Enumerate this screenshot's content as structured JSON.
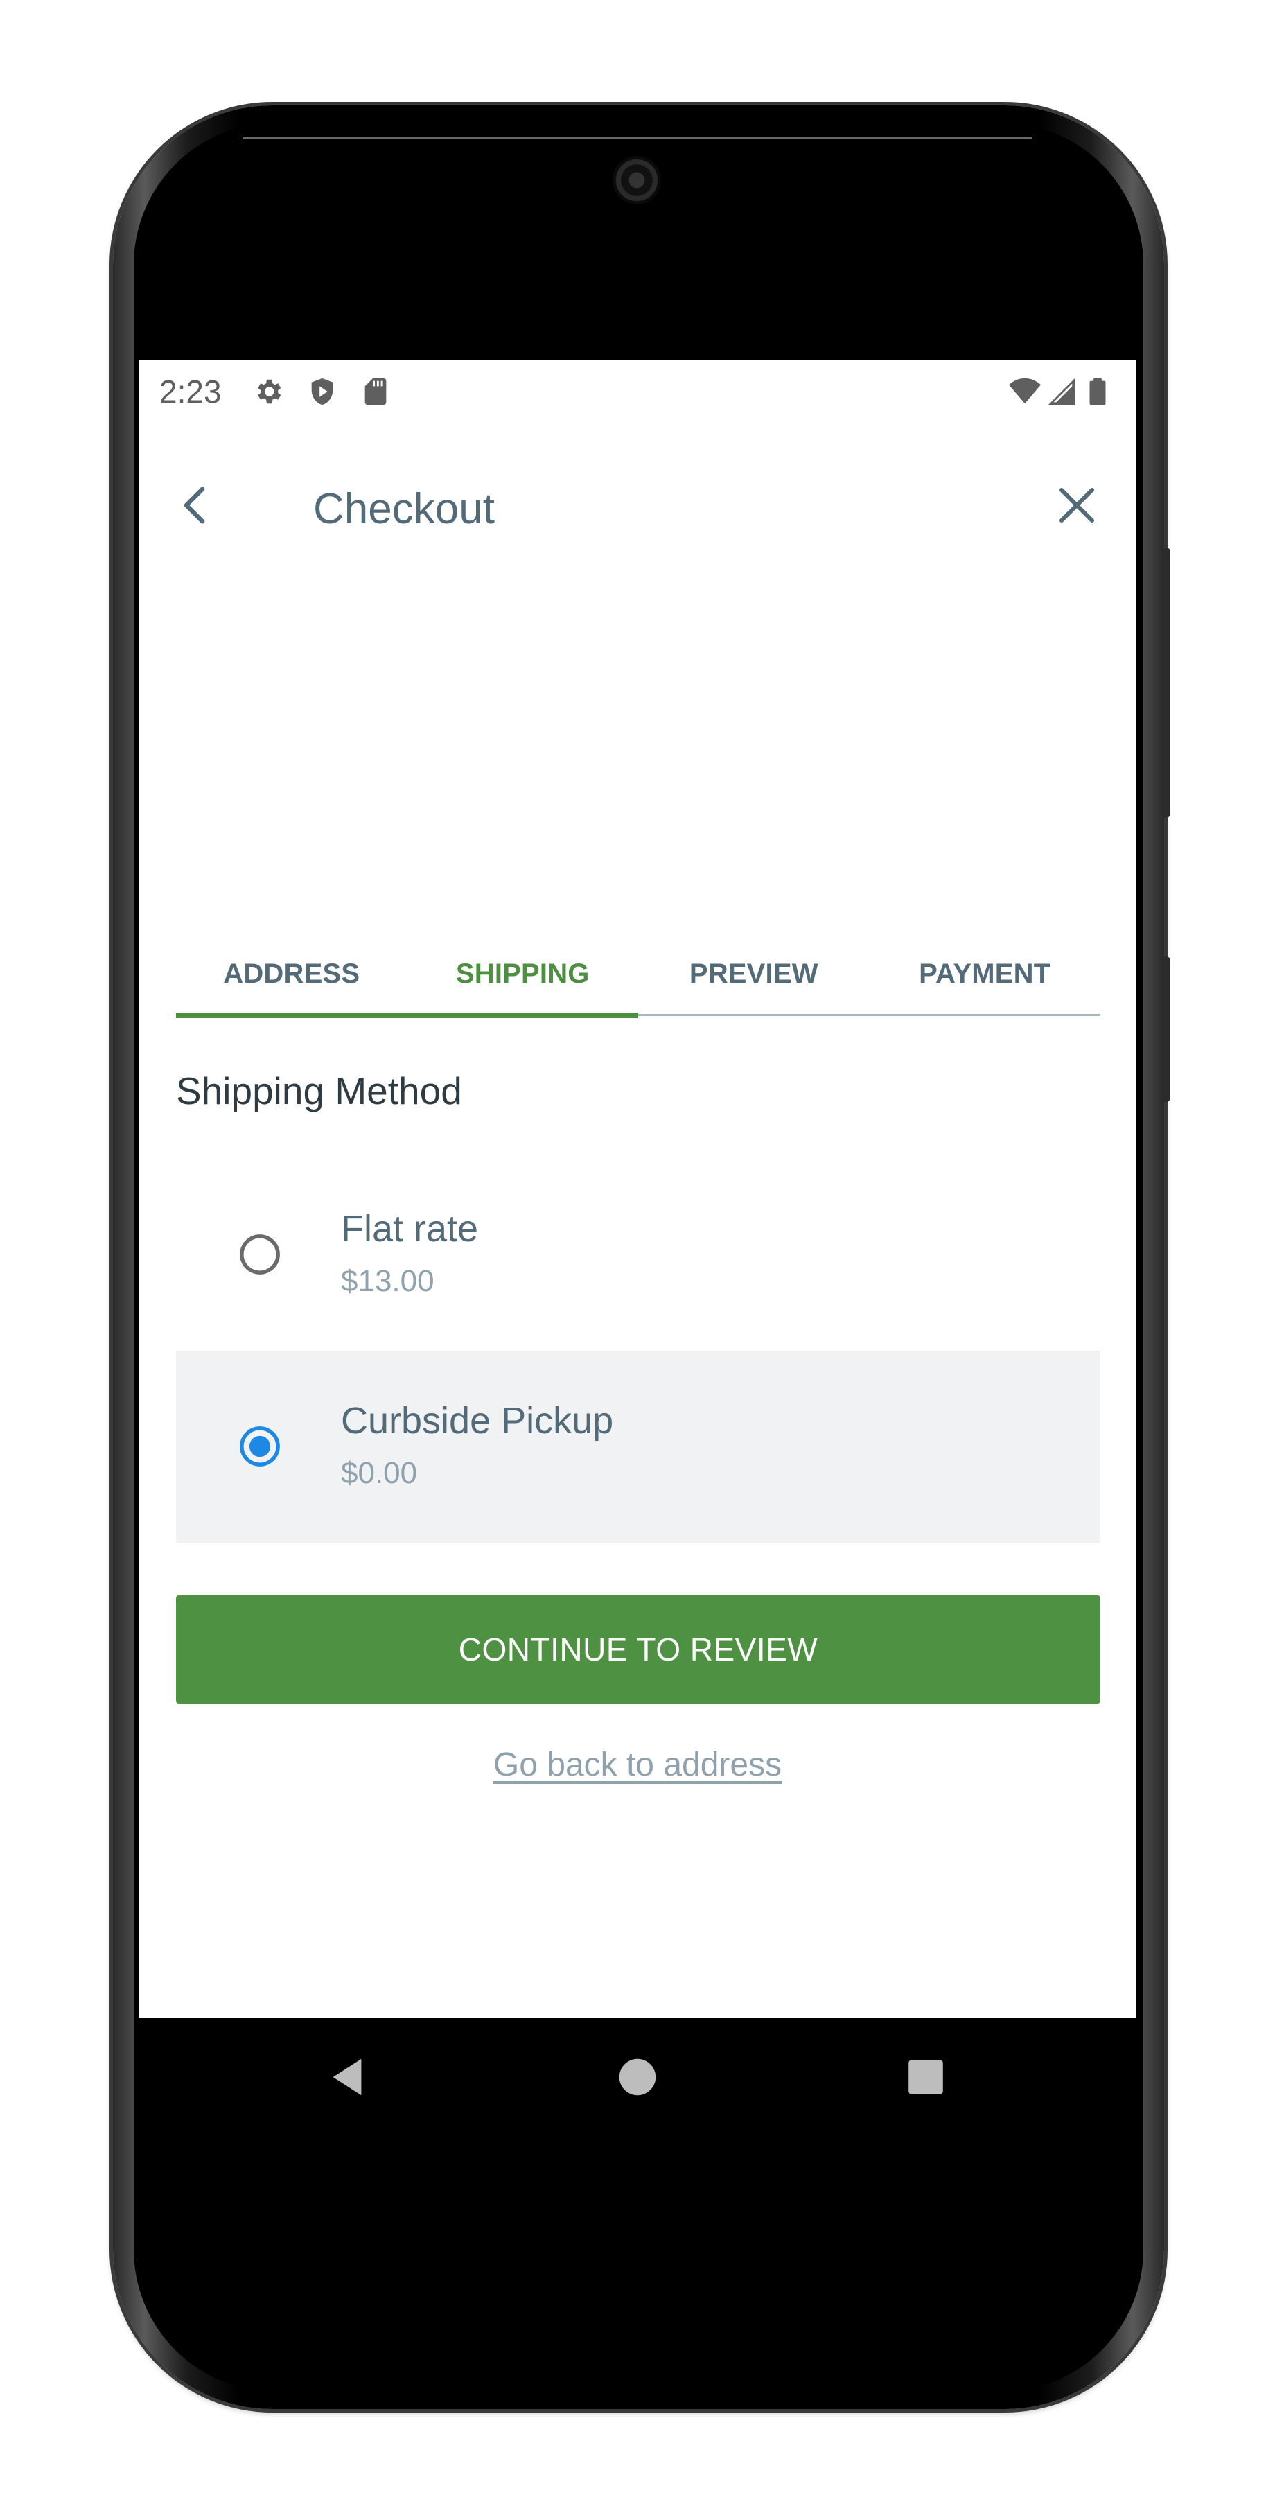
{
  "status_bar": {
    "time": "2:23",
    "left_icons": [
      "gear-icon",
      "shield-icon",
      "sd-card-icon"
    ],
    "right_icons": [
      "wifi-icon",
      "signal-icon",
      "battery-icon"
    ]
  },
  "app_bar": {
    "title": "Checkout",
    "back_icon": "chevron-left-icon",
    "close_icon": "close-icon"
  },
  "tabs": [
    {
      "label": "ADDRESS",
      "state": "completed"
    },
    {
      "label": "SHIPPING",
      "state": "active"
    },
    {
      "label": "PREVIEW",
      "state": "upcoming"
    },
    {
      "label": "PAYMENT",
      "state": "upcoming"
    }
  ],
  "progress_fraction": 0.5,
  "section_title": "Shipping Method",
  "shipping_options": [
    {
      "name": "Flat rate",
      "price": "$13.00",
      "selected": false
    },
    {
      "name": "Curbside Pickup",
      "price": "$0.00",
      "selected": true
    }
  ],
  "primary_button": "CONTINUE TO REVIEW",
  "secondary_link": "Go back to address",
  "nav_bar": {
    "icons": [
      "back-triangle-icon",
      "home-circle-icon",
      "recents-square-icon"
    ]
  },
  "colors": {
    "accent_green": "#4f9142",
    "text_slate": "#536a79",
    "muted_text": "#8fa1ad",
    "selected_bg": "#f0f2f3",
    "radio_blue": "#1e88e5"
  }
}
